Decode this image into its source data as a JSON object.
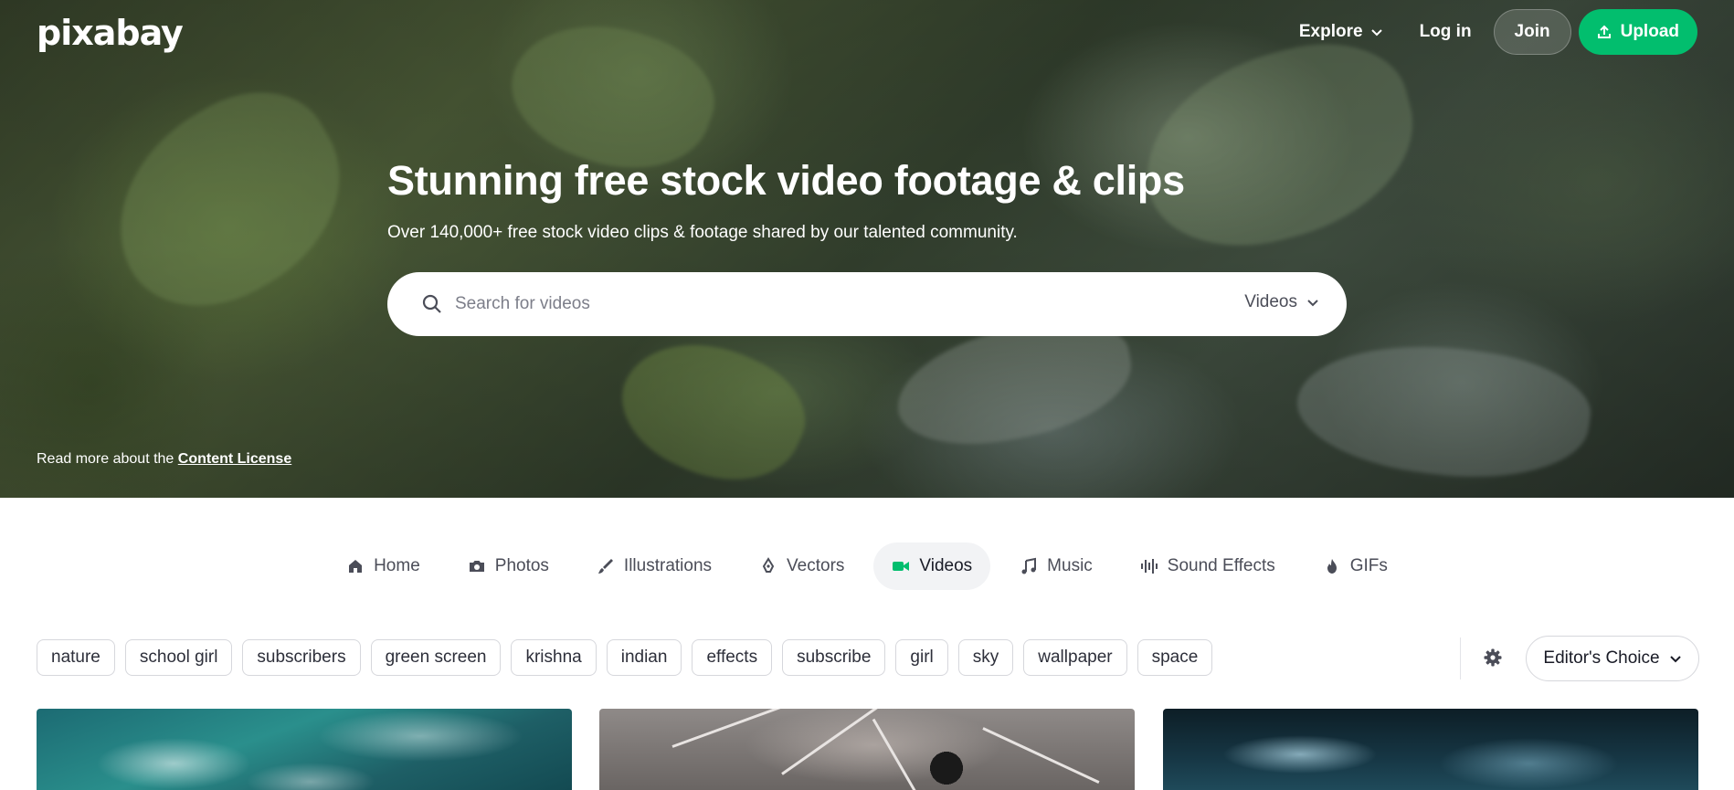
{
  "header": {
    "logo": "pixabay",
    "explore_label": "Explore",
    "login_label": "Log in",
    "join_label": "Join",
    "upload_label": "Upload"
  },
  "hero": {
    "title": "Stunning free stock video footage & clips",
    "subtitle": "Over 140,000+ free stock video clips & footage shared by our talented community.",
    "search": {
      "placeholder": "Search for videos",
      "type_label": "Videos"
    },
    "license_text": "Read more about the ",
    "license_link": "Content License"
  },
  "tabs": [
    {
      "label": "Home",
      "icon": "home-icon"
    },
    {
      "label": "Photos",
      "icon": "camera-icon"
    },
    {
      "label": "Illustrations",
      "icon": "brush-icon"
    },
    {
      "label": "Vectors",
      "icon": "pen-tool-icon"
    },
    {
      "label": "Videos",
      "icon": "video-camera-icon",
      "active": true
    },
    {
      "label": "Music",
      "icon": "music-note-icon"
    },
    {
      "label": "Sound Effects",
      "icon": "sound-wave-icon"
    },
    {
      "label": "GIFs",
      "icon": "flame-icon"
    }
  ],
  "tags": [
    "nature",
    "school girl",
    "subscribers",
    "green screen",
    "krishna",
    "indian",
    "effects",
    "subscribe",
    "girl",
    "sky",
    "wallpaper",
    "space"
  ],
  "sort": {
    "label": "Editor's Choice"
  },
  "colors": {
    "accent": "#02be6e",
    "active_tab_bg": "#f2f3f5",
    "text": "#191b26"
  }
}
